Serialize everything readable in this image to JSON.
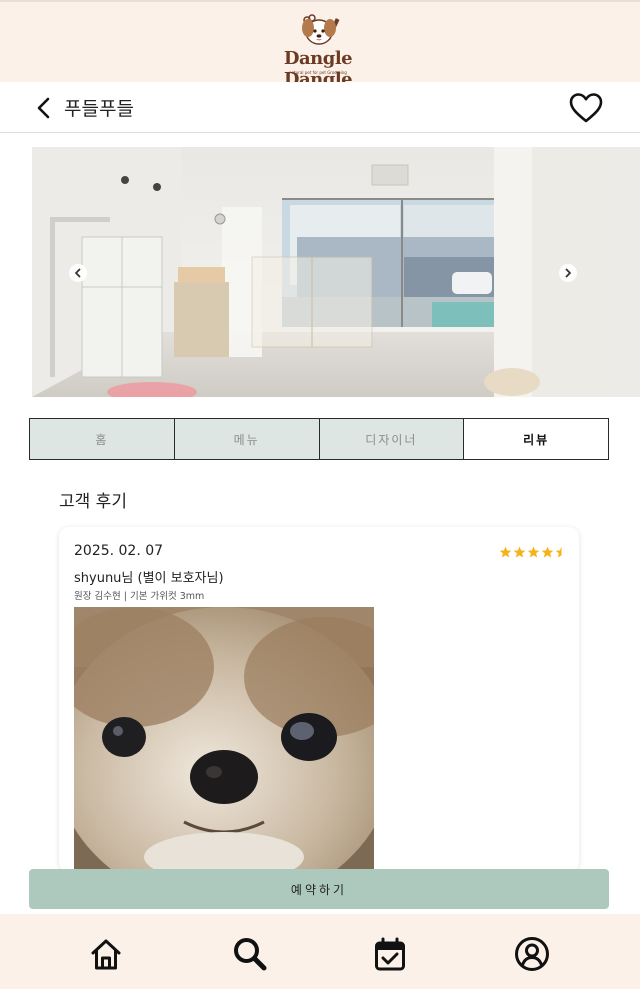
{
  "brand": {
    "name": "Dangle Dangle",
    "tagline": "natural pet for pet Grooming"
  },
  "header": {
    "shop_name": "푸들푸들",
    "back_icon": "chevron-left-icon",
    "favorite_icon": "heart-outline-icon"
  },
  "carousel": {
    "prev_icon": "arrow-left-circle-icon",
    "next_icon": "arrow-right-circle-icon"
  },
  "tabs": [
    {
      "label": "홈",
      "active": false
    },
    {
      "label": "메뉴",
      "active": false
    },
    {
      "label": "디자이너",
      "active": false
    },
    {
      "label": "리뷰",
      "active": true
    }
  ],
  "reviews_section": {
    "title": "고객 후기"
  },
  "review": {
    "date": "2025. 02. 07",
    "user": "shyunu님 (별이 보호자님)",
    "service": "원장 김수현 | 기본 가위컷 3mm",
    "rating": 4.5,
    "rating_max": 5
  },
  "reserve": {
    "label": "예약하기"
  },
  "bottom_nav": [
    {
      "icon": "home-icon"
    },
    {
      "icon": "search-icon"
    },
    {
      "icon": "calendar-check-icon"
    },
    {
      "icon": "user-circle-icon"
    }
  ],
  "colors": {
    "brand_bg": "#fcf1e8",
    "tab_inactive_bg": "#dde6e2",
    "reserve_bg": "#adc9bd",
    "star": "#f5b21a",
    "logo_brown": "#6b3b23"
  }
}
